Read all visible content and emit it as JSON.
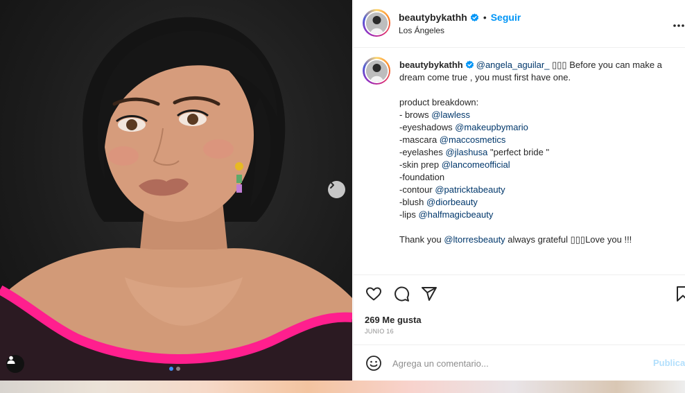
{
  "post": {
    "header": {
      "username": "beautybykathh",
      "separator": "•",
      "follow_label": "Seguir",
      "location": "Los Ángeles",
      "more_icon": "more-horizontal-icon"
    },
    "caption": {
      "username": "beautybykathh",
      "mention_tag": "@angela_aguilar_",
      "emoji_placeholder": "▯▯▯",
      "intro": "Before you can make a dream come true , you must first have one.",
      "breakdown_title": "product breakdown:",
      "lines": [
        {
          "prefix": "- brows ",
          "mention": "@lawless",
          "suffix": ""
        },
        {
          "prefix": "-eyeshadows ",
          "mention": "@makeupbymario",
          "suffix": ""
        },
        {
          "prefix": "-mascara ",
          "mention": "@maccosmetics",
          "suffix": ""
        },
        {
          "prefix": "-eyelashes ",
          "mention": "@jlashusa",
          "suffix": " \"perfect bride \""
        },
        {
          "prefix": "-skin prep ",
          "mention": "@lancomeofficial",
          "suffix": ""
        },
        {
          "prefix": "-foundation",
          "mention": "",
          "suffix": ""
        },
        {
          "prefix": "-contour ",
          "mention": "@patricktabeauty",
          "suffix": ""
        },
        {
          "prefix": "-blush ",
          "mention": "@diorbeauty",
          "suffix": ""
        },
        {
          "prefix": "-lips ",
          "mention": "@halfmagicbeauty",
          "suffix": ""
        }
      ],
      "thanks_prefix": "Thank you ",
      "thanks_mention": "@ltorresbeauty",
      "thanks_suffix": " always grateful ▯▯▯Love you !!!"
    },
    "actions": {
      "like_icon": "heart-icon",
      "comment_icon": "comment-icon",
      "share_icon": "share-icon",
      "save_icon": "bookmark-icon",
      "likes_text": "269 Me gusta",
      "date": "JUNIO 16"
    },
    "comment_box": {
      "emoji_icon": "emoji-icon",
      "placeholder": "Agrega un comentario...",
      "publish_label": "Publicar"
    },
    "carousel": {
      "slide_count": 2,
      "active_slide": 1,
      "next_icon": "chevron-right-icon",
      "user_tag_icon": "user-tag-icon"
    },
    "colors": {
      "accent": "#0095f6",
      "mention": "#00376b",
      "publish_disabled": "#b2dffc",
      "dress_pink": "#ff1f8e"
    }
  }
}
